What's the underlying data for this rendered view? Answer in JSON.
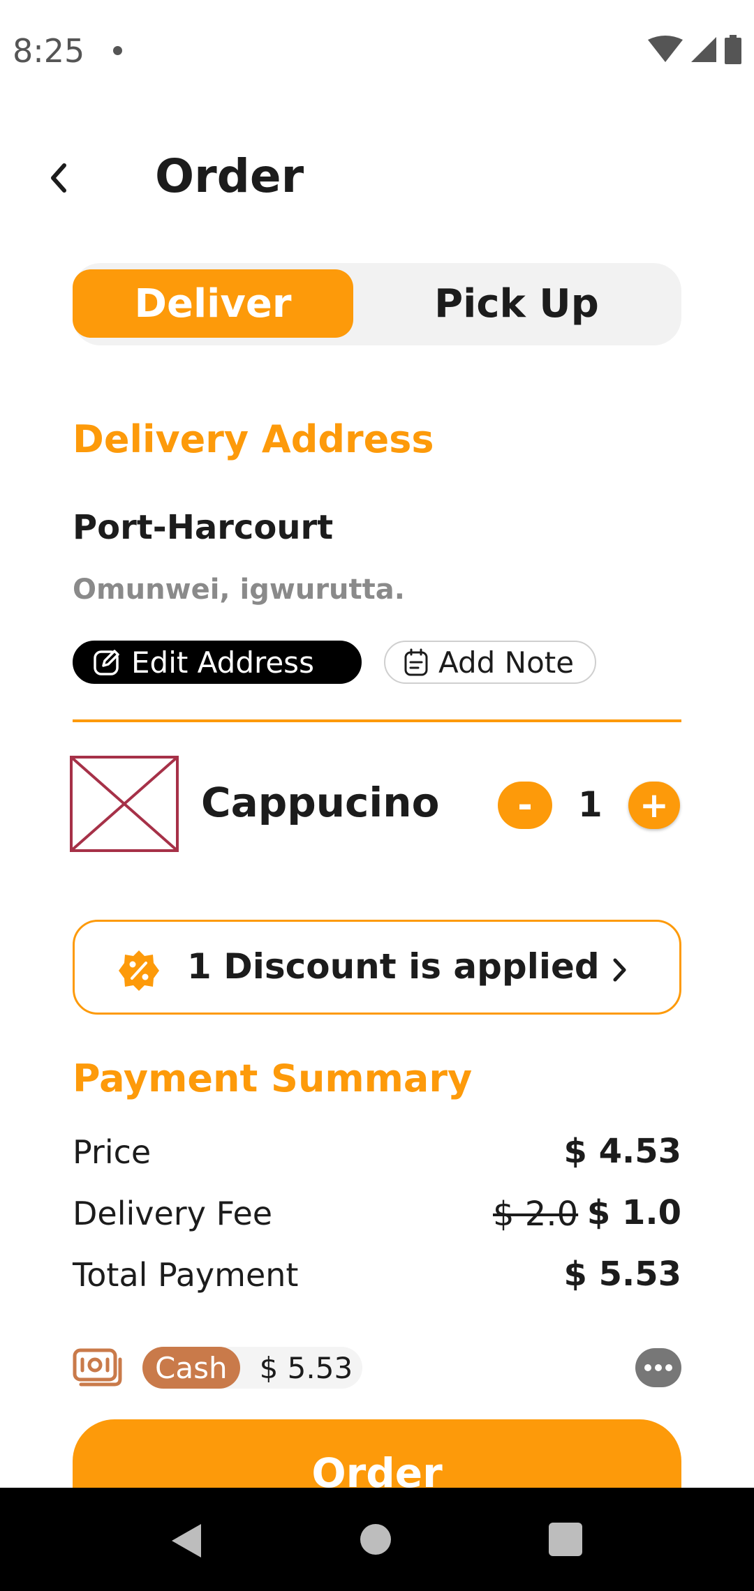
{
  "status_bar": {
    "time": "8:25"
  },
  "header": {
    "title": "Order"
  },
  "mode_toggle": {
    "deliver_label": "Deliver",
    "pickup_label": "Pick Up",
    "selected": "Deliver"
  },
  "address": {
    "heading": "Delivery Address",
    "city": "Port-Harcourt",
    "street": "Omunwei, igwurutta.",
    "edit_label": "Edit Address",
    "note_label": "Add Note"
  },
  "item": {
    "name": "Cappucino",
    "quantity": "1",
    "minus_label": "-",
    "plus_label": "+"
  },
  "discount": {
    "text": "1 Discount is applied"
  },
  "payment_summary": {
    "heading": "Payment Summary",
    "price_label": "Price",
    "price_value": "$ 4.53",
    "fee_label": "Delivery Fee",
    "fee_original": "$ 2.0",
    "fee_value": "$ 1.0",
    "total_label": "Total Payment",
    "total_value": "$ 5.53"
  },
  "payment_method": {
    "method": "Cash",
    "amount": "$ 5.53"
  },
  "order_button": {
    "label": "Order"
  },
  "colors": {
    "accent": "#fd9a0a",
    "cash_badge": "#c97a4a",
    "divider": "#fd9a0a"
  }
}
